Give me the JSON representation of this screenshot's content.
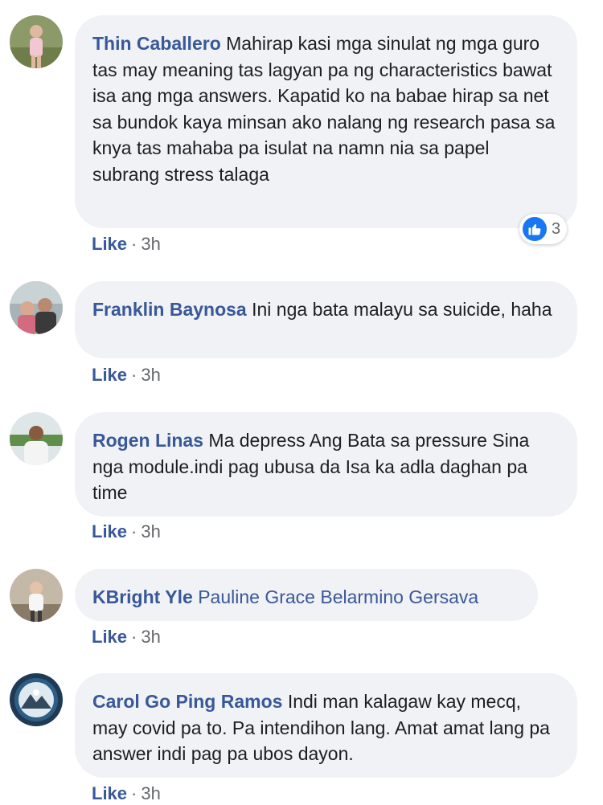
{
  "comments": [
    {
      "author": "Thin Caballero",
      "text": "Mahirap kasi mga sinulat ng mga guro tas may meaning tas lagyan pa ng characteristics bawat isa ang mga answers. Kapatid ko na babae hirap sa net sa bundok kaya minsan ako nalang ng research pasa sa knya tas mahaba pa isulat na namn nia sa papel subrang stress talaga",
      "like_label": "Like",
      "separator": "·",
      "time": "3h",
      "reaction_count": "3"
    },
    {
      "author": "Franklin Baynosa",
      "text": "Ini nga bata malayu sa suicide, haha",
      "like_label": "Like",
      "separator": "·",
      "time": "3h"
    },
    {
      "author": "Rogen Linas",
      "text": "Ma depress Ang Bata sa pressure Sina nga module.indi pag ubusa da Isa ka adla daghan pa time",
      "like_label": "Like",
      "separator": "·",
      "time": "3h"
    },
    {
      "author": "KBright Yle",
      "tag": "Pauline Grace Belarmino Gersava",
      "like_label": "Like",
      "separator": "·",
      "time": "3h"
    },
    {
      "author": "Carol Go Ping Ramos",
      "text": "Indi man kalagaw kay mecq, may covid pa to. Pa intendihon lang. Amat amat lang pa answer indi pag pa ubos dayon.",
      "like_label": "Like",
      "separator": "·",
      "time": "3h"
    }
  ],
  "colors": {
    "author": "#385898",
    "bubble": "#f0f2f5",
    "like_reaction": "#1877f2"
  },
  "icons": {
    "reaction": "like-thumb-icon"
  }
}
